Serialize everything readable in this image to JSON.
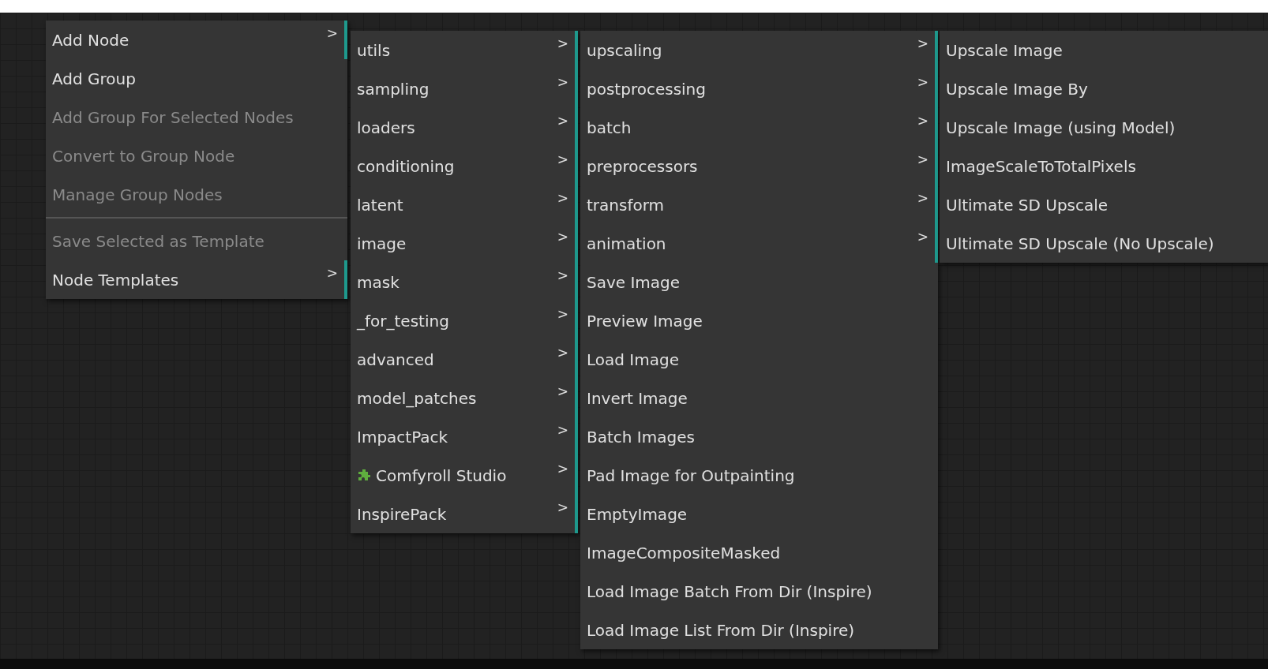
{
  "menus": [
    {
      "items": [
        {
          "kind": "item",
          "label": "Add Node",
          "arrow": ">",
          "disabled": false
        },
        {
          "kind": "item",
          "label": "Add Group",
          "disabled": false
        },
        {
          "kind": "item",
          "label": "Add Group For Selected Nodes",
          "disabled": true
        },
        {
          "kind": "item",
          "label": "Convert to Group Node",
          "disabled": true
        },
        {
          "kind": "item",
          "label": "Manage Group Nodes",
          "disabled": true
        },
        {
          "kind": "separator"
        },
        {
          "kind": "item",
          "label": "Save Selected as Template",
          "disabled": true
        },
        {
          "kind": "item",
          "label": "Node Templates",
          "arrow": ">",
          "disabled": false
        }
      ]
    },
    {
      "items": [
        {
          "kind": "item",
          "label": "utils",
          "arrow": ">"
        },
        {
          "kind": "item",
          "label": "sampling",
          "arrow": ">"
        },
        {
          "kind": "item",
          "label": "loaders",
          "arrow": ">"
        },
        {
          "kind": "item",
          "label": "conditioning",
          "arrow": ">"
        },
        {
          "kind": "item",
          "label": "latent",
          "arrow": ">"
        },
        {
          "kind": "item",
          "label": "image",
          "arrow": ">"
        },
        {
          "kind": "item",
          "label": "mask",
          "arrow": ">"
        },
        {
          "kind": "item",
          "label": "_for_testing",
          "arrow": ">"
        },
        {
          "kind": "item",
          "label": "advanced",
          "arrow": ">"
        },
        {
          "kind": "item",
          "label": "model_patches",
          "arrow": ">"
        },
        {
          "kind": "item",
          "label": "ImpactPack",
          "arrow": ">"
        },
        {
          "kind": "plugin",
          "label": "Comfyroll Studio",
          "arrow": ">"
        },
        {
          "kind": "item",
          "label": "InspirePack",
          "arrow": ">"
        }
      ]
    },
    {
      "items": [
        {
          "kind": "item",
          "label": "upscaling",
          "arrow": ">"
        },
        {
          "kind": "item",
          "label": "postprocessing",
          "arrow": ">"
        },
        {
          "kind": "item",
          "label": "batch",
          "arrow": ">"
        },
        {
          "kind": "item",
          "label": "preprocessors",
          "arrow": ">"
        },
        {
          "kind": "item",
          "label": "transform",
          "arrow": ">"
        },
        {
          "kind": "item",
          "label": "animation",
          "arrow": ">"
        },
        {
          "kind": "item",
          "label": "Save Image"
        },
        {
          "kind": "item",
          "label": "Preview Image"
        },
        {
          "kind": "item",
          "label": "Load Image"
        },
        {
          "kind": "item",
          "label": "Invert Image"
        },
        {
          "kind": "item",
          "label": "Batch Images"
        },
        {
          "kind": "item",
          "label": "Pad Image for Outpainting"
        },
        {
          "kind": "item",
          "label": "EmptyImage"
        },
        {
          "kind": "item",
          "label": "ImageCompositeMasked"
        },
        {
          "kind": "item",
          "label": "Load Image Batch From Dir (Inspire)"
        },
        {
          "kind": "item",
          "label": "Load Image List From Dir (Inspire)"
        }
      ]
    },
    {
      "items": [
        {
          "kind": "item",
          "label": "Upscale Image"
        },
        {
          "kind": "item",
          "label": "Upscale Image By"
        },
        {
          "kind": "item",
          "label": "Upscale Image (using Model)"
        },
        {
          "kind": "item",
          "label": "ImageScaleToTotalPixels"
        },
        {
          "kind": "item",
          "label": "Ultimate SD Upscale"
        },
        {
          "kind": "item",
          "label": "Ultimate SD Upscale (No Upscale)"
        }
      ]
    }
  ]
}
